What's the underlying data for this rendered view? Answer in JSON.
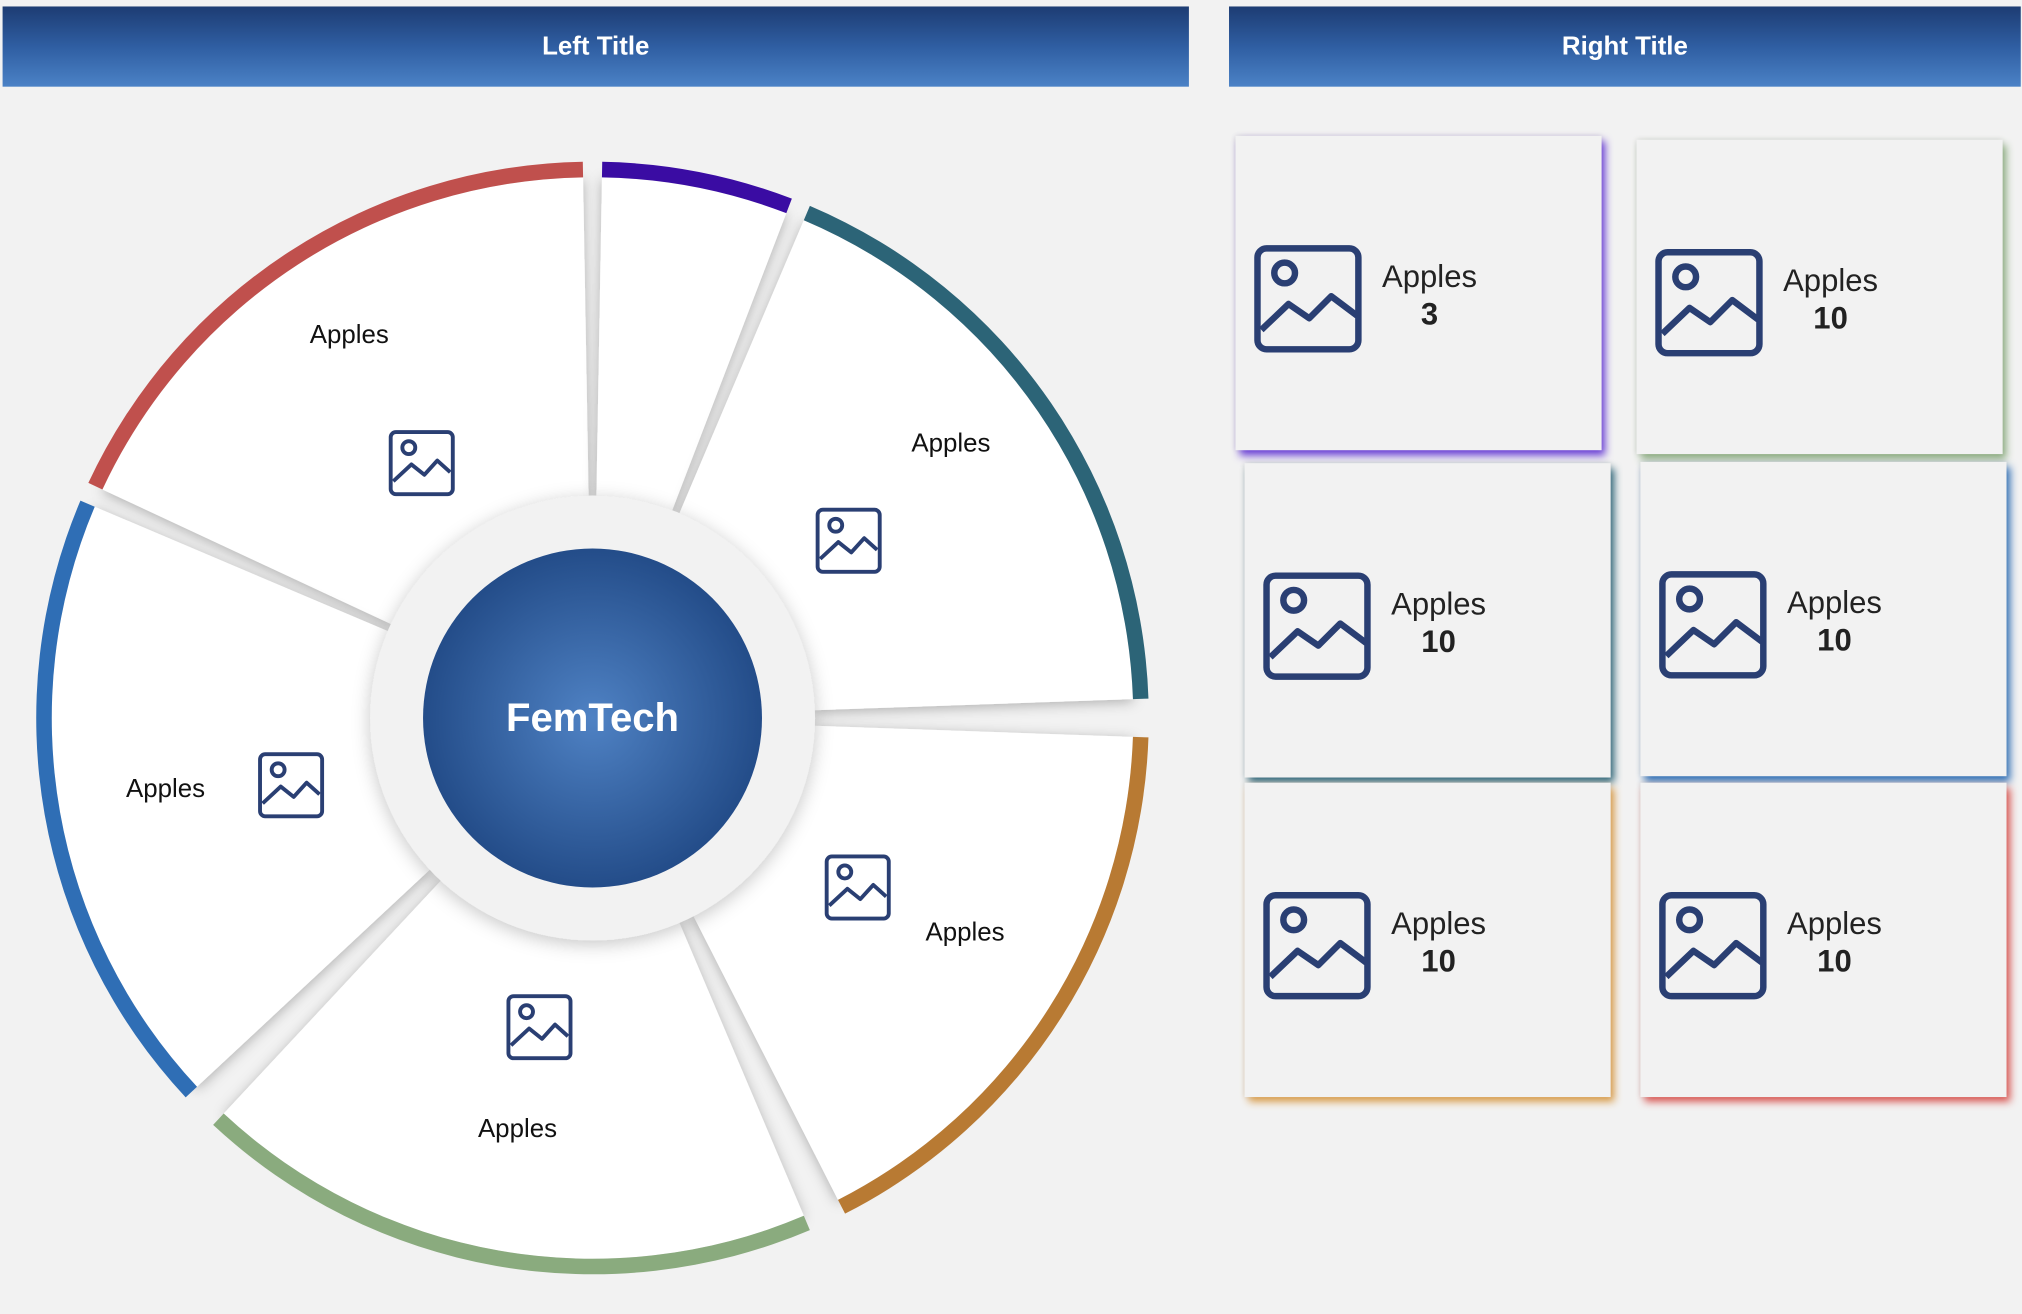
{
  "left_panel": {
    "title": "Left Title"
  },
  "right_panel": {
    "title": "Right Title"
  },
  "wheel": {
    "center_label": "FemTech",
    "segments": [
      {
        "label": "Apples",
        "accent": "#c0504d",
        "icon": "image-placeholder-icon"
      },
      {
        "label": "",
        "accent": "#3a0ca3",
        "icon": ""
      },
      {
        "label": "Apples",
        "accent": "#2c6477",
        "icon": "image-placeholder-icon"
      },
      {
        "label": "Apples",
        "accent": "#b87a33",
        "icon": "image-placeholder-icon"
      },
      {
        "label": "Apples",
        "accent": "#8aab7e",
        "icon": "image-placeholder-icon"
      },
      {
        "label": "Apples",
        "accent": "#2f6eb5",
        "icon": "image-placeholder-icon"
      }
    ]
  },
  "tiles": [
    {
      "label": "Apples",
      "value": "3",
      "accent": "#6a3fd6",
      "icon": "image-placeholder-icon"
    },
    {
      "label": "Apples",
      "value": "10",
      "accent": "#8aab7e",
      "icon": "image-placeholder-icon"
    },
    {
      "label": "Apples",
      "value": "10",
      "accent": "#2c6477",
      "icon": "image-placeholder-icon"
    },
    {
      "label": "Apples",
      "value": "10",
      "accent": "#2f6eb5",
      "icon": "image-placeholder-icon"
    },
    {
      "label": "Apples",
      "value": "10",
      "accent": "#d99a45",
      "icon": "image-placeholder-icon"
    },
    {
      "label": "Apples",
      "value": "10",
      "accent": "#d9534f",
      "icon": "image-placeholder-icon"
    }
  ],
  "colors": {
    "header_dark": "#1d3c73",
    "header_light": "#4b82c6",
    "hub": "#2f5a9a",
    "icon_stroke": "#2a3f73"
  }
}
